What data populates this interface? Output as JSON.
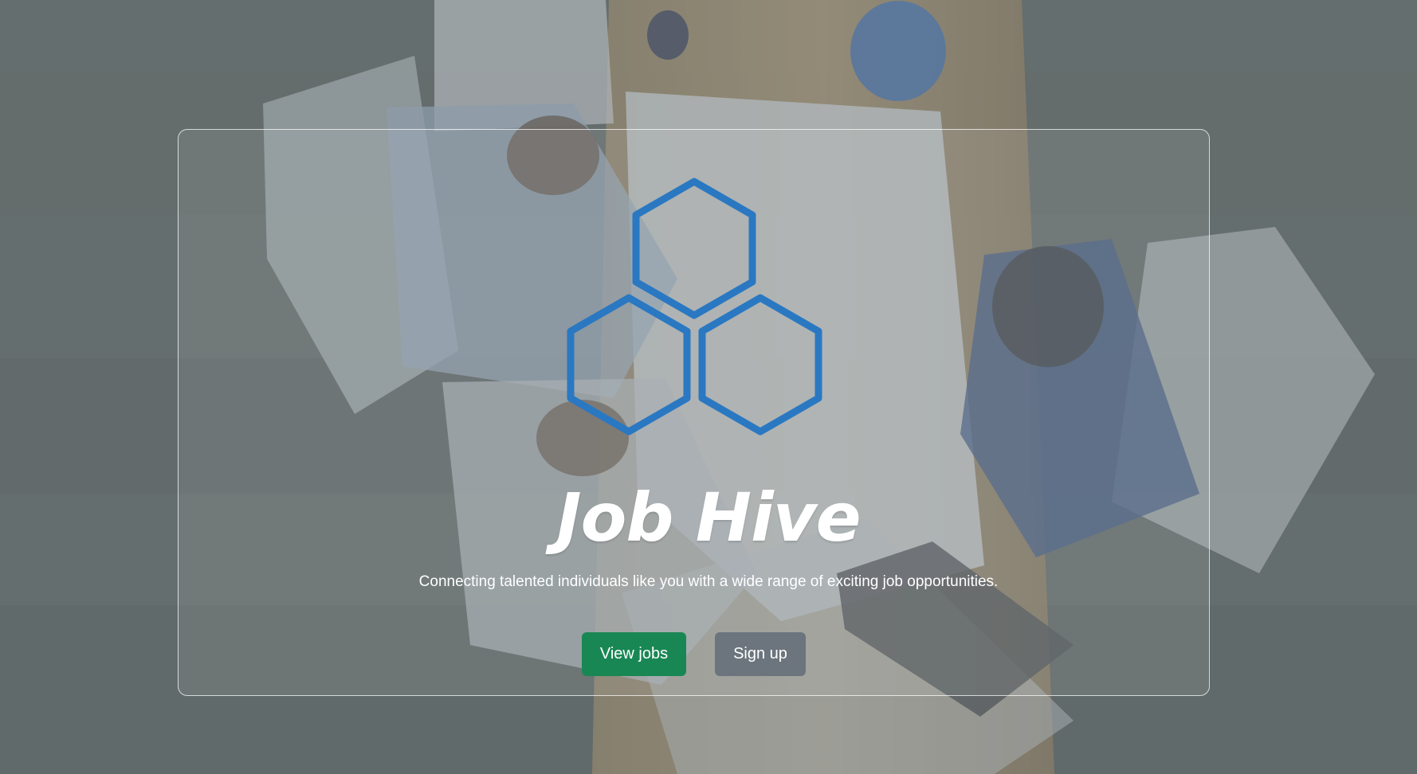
{
  "hero": {
    "title": "Job Hive",
    "tagline": "Connecting talented individuals like you with a wide range of exciting job opportunities.",
    "logo_icon": "hexagon-cluster-logo",
    "colors": {
      "logo": "#2a78c2",
      "primary_button": "#198754",
      "secondary_button": "#6c757d",
      "text": "#ffffff"
    }
  },
  "actions": {
    "view_jobs": "View jobs",
    "sign_up": "Sign up"
  }
}
